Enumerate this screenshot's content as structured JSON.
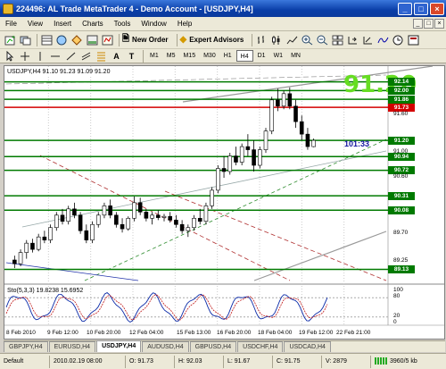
{
  "window": {
    "title": "224496: AL Trade MetaTrader 4 - Demo Account - [USDJPY,H4]",
    "min": "_",
    "max": "□",
    "close": "×"
  },
  "menu": {
    "items": [
      "File",
      "View",
      "Insert",
      "Charts",
      "Tools",
      "Window",
      "Help"
    ]
  },
  "toolbar": {
    "new_order": "New Order",
    "expert_advisors": "Expert Advisors"
  },
  "timeframes": [
    "M1",
    "M5",
    "M15",
    "M30",
    "H1",
    "H4",
    "D1",
    "W1",
    "MN"
  ],
  "active_timeframe": "H4",
  "chart": {
    "symbol_info": "USDJPY,H4  91.10 91.23 91.09 91.20",
    "big_price": "91.20",
    "countdown": "101:33",
    "price_labels": [
      {
        "text": "92.14",
        "color": "#007a00"
      },
      {
        "text": "92.00",
        "color": "#007a00"
      },
      {
        "text": "91.86",
        "color": "#007a00"
      },
      {
        "text": "91.73",
        "color": "#d40000"
      },
      {
        "text": "91.20",
        "color": "#007a00"
      },
      {
        "text": "90.94",
        "color": "#007a00"
      },
      {
        "text": "90.72",
        "color": "#007a00"
      },
      {
        "text": "90.31",
        "color": "#007a00"
      },
      {
        "text": "90.08",
        "color": "#007a00"
      },
      {
        "text": "89.13",
        "color": "#007a00"
      }
    ],
    "y_labels": [
      "91.60",
      "91.00",
      "90.60",
      "89.70",
      "89.25"
    ],
    "stoch_label": "Sto(5,3,3) 19.8238 15.6952",
    "stoch_levels": [
      "100",
      "80",
      "20",
      "0"
    ],
    "x_labels": [
      "8 Feb 2010",
      "9 Feb 12:00",
      "10 Feb 20:00",
      "12 Feb 04:00",
      "15 Feb 13:00",
      "16 Feb 20:00",
      "18 Feb 04:00",
      "19 Feb 12:00",
      "22 Feb 21:00"
    ]
  },
  "tabs": [
    "GBPJPY,H4",
    "EURUSD,H4",
    "USDJPY,H4",
    "AUDUSD,H4",
    "GBPUSD,H4",
    "USDCHF,H4",
    "USDCAD,H4"
  ],
  "active_tab": "USDJPY,H4",
  "status": {
    "profile": "Default",
    "datetime": "2010.02.19 08:00",
    "open": "O: 91.73",
    "high": "H: 92.03",
    "low": "L: 91.67",
    "close": "C: 91.75",
    "volume": "V: 2879",
    "traffic": "3960/5 kb"
  },
  "chart_data": {
    "type": "candlestick",
    "ohlc_close_last": 91.2,
    "candles": [
      [
        89.28,
        89.35,
        89.15,
        89.22
      ],
      [
        89.22,
        89.45,
        89.18,
        89.4
      ],
      [
        89.4,
        89.6,
        89.3,
        89.55
      ],
      [
        89.55,
        89.62,
        89.4,
        89.45
      ],
      [
        89.45,
        89.7,
        89.42,
        89.65
      ],
      [
        89.65,
        89.75,
        89.55,
        89.6
      ],
      [
        89.6,
        89.85,
        89.55,
        89.8
      ],
      [
        89.8,
        90.05,
        89.75,
        90.0
      ],
      [
        90.0,
        90.1,
        89.85,
        89.9
      ],
      [
        89.9,
        90.15,
        89.85,
        90.1
      ],
      [
        90.1,
        90.2,
        89.95,
        90.0
      ],
      [
        90.0,
        90.05,
        89.7,
        89.75
      ],
      [
        89.75,
        89.85,
        89.55,
        89.6
      ],
      [
        89.6,
        89.9,
        89.55,
        89.85
      ],
      [
        89.85,
        90.05,
        89.8,
        90.0
      ],
      [
        90.0,
        90.2,
        89.95,
        90.15
      ],
      [
        90.15,
        90.25,
        89.95,
        90.0
      ],
      [
        90.0,
        90.05,
        89.8,
        89.85
      ],
      [
        89.85,
        89.95,
        89.72,
        89.78
      ],
      [
        89.78,
        89.98,
        89.75,
        89.95
      ],
      [
        89.95,
        90.3,
        89.9,
        90.2
      ],
      [
        90.2,
        90.28,
        90.0,
        90.05
      ],
      [
        90.05,
        90.1,
        89.9,
        89.95
      ],
      [
        89.95,
        90.05,
        89.85,
        90.0
      ],
      [
        90.0,
        90.08,
        89.92,
        89.96
      ],
      [
        89.96,
        90.02,
        89.9,
        89.98
      ],
      [
        89.98,
        90.05,
        89.88,
        89.92
      ],
      [
        89.92,
        90.0,
        89.8,
        89.85
      ],
      [
        89.85,
        89.92,
        89.7,
        89.75
      ],
      [
        89.75,
        89.85,
        89.65,
        89.8
      ],
      [
        89.8,
        90.0,
        89.75,
        89.95
      ],
      [
        89.95,
        90.1,
        89.85,
        89.9
      ],
      [
        89.9,
        90.2,
        89.85,
        90.15
      ],
      [
        90.15,
        90.45,
        90.1,
        90.4
      ],
      [
        90.4,
        90.8,
        90.35,
        90.75
      ],
      [
        90.75,
        90.95,
        90.6,
        90.7
      ],
      [
        90.7,
        91.0,
        90.65,
        90.95
      ],
      [
        90.95,
        91.1,
        90.8,
        90.85
      ],
      [
        90.85,
        91.15,
        90.8,
        91.1
      ],
      [
        91.1,
        91.3,
        90.95,
        91.05
      ],
      [
        91.05,
        91.2,
        90.7,
        90.8
      ],
      [
        90.8,
        91.1,
        90.75,
        91.05
      ],
      [
        91.05,
        91.4,
        91.0,
        91.35
      ],
      [
        91.35,
        91.9,
        91.3,
        91.85
      ],
      [
        91.85,
        92.03,
        91.67,
        91.75
      ],
      [
        91.75,
        92.0,
        91.7,
        91.95
      ],
      [
        91.95,
        92.05,
        91.7,
        91.75
      ],
      [
        91.75,
        91.85,
        91.4,
        91.5
      ],
      [
        91.5,
        91.6,
        91.2,
        91.3
      ],
      [
        91.3,
        91.4,
        91.05,
        91.1
      ],
      [
        91.1,
        91.23,
        91.09,
        91.2
      ]
    ],
    "levels": [
      92.14,
      92.0,
      91.86,
      91.73,
      91.2,
      90.94,
      90.72,
      90.31,
      90.08,
      89.13
    ],
    "ylim": [
      88.95,
      92.22
    ]
  }
}
